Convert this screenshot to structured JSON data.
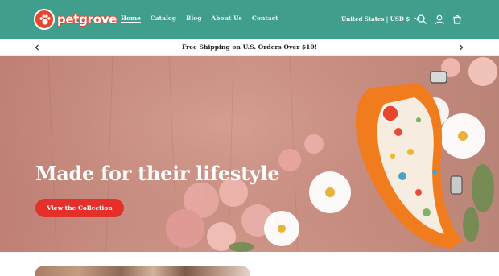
{
  "brand": {
    "name": "petgrove"
  },
  "nav": {
    "items": [
      {
        "label": "Home",
        "active": true
      },
      {
        "label": "Catalog",
        "active": false
      },
      {
        "label": "Blog",
        "active": false
      },
      {
        "label": "About Us",
        "active": false
      },
      {
        "label": "Contact",
        "active": false
      }
    ]
  },
  "header": {
    "currency": "United States | USD $",
    "icons": [
      "search-icon",
      "account-icon",
      "cart-icon"
    ]
  },
  "announcement": {
    "text": "Free Shipping on U.S. Orders Over $10!"
  },
  "hero": {
    "title": "Made for their lifestyle",
    "button_label": "View the Collection",
    "image": "orange-patterned-dog-harness-with-flowers"
  },
  "colors": {
    "header_bg": "#3f9f8c",
    "accent": "#e42f2b",
    "text_dark": "#1b1b1b"
  }
}
